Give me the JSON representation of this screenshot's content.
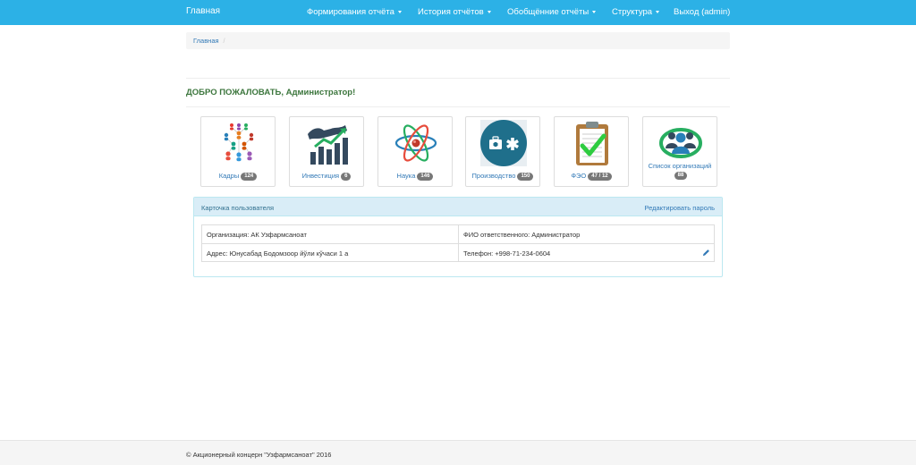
{
  "navbar": {
    "brand": "Главная",
    "items": [
      {
        "label": "Формирования отчёта"
      },
      {
        "label": "История отчётов"
      },
      {
        "label": "Обобщённие отчёты"
      },
      {
        "label": "Структура"
      },
      {
        "label": "Выход (admin)"
      }
    ]
  },
  "breadcrumb": {
    "home": "Главная",
    "separator": "/"
  },
  "welcome": "ДОБРО ПОЖАЛОВАТЬ, Администратор!",
  "tiles": [
    {
      "label": "Кадры",
      "count": "124",
      "icon": "people-network-icon"
    },
    {
      "label": "Инвестиция",
      "count": "6",
      "icon": "investment-chart-icon"
    },
    {
      "label": "Наука",
      "count": "146",
      "icon": "atom-icon"
    },
    {
      "label": "Производство",
      "count": "150",
      "icon": "medical-kit-icon"
    },
    {
      "label": "ФЭО",
      "count": "47 / 12",
      "icon": "clipboard-check-icon"
    },
    {
      "label": "Список организаций",
      "count": "88",
      "icon": "organization-group-icon"
    }
  ],
  "user_card": {
    "title": "Карточка пользователя",
    "edit_password": "Редактировать пароль",
    "organization": "Организация: АК Узфармсаноат",
    "responsible": "ФИО ответственного: Администратор",
    "address": "Адрес: Юнусабад Бодомзоор йўли кўчаси 1 а",
    "phone": "Телефон: +998-71-234-0604"
  },
  "footer": "© Акционерный концерн \"Узфармсаноат\" 2016",
  "colors": {
    "navbar": "#2cb1e6",
    "welcome": "#3c763d",
    "link": "#337ab7",
    "panel_head": "#d9edf7",
    "badge": "#777777"
  }
}
